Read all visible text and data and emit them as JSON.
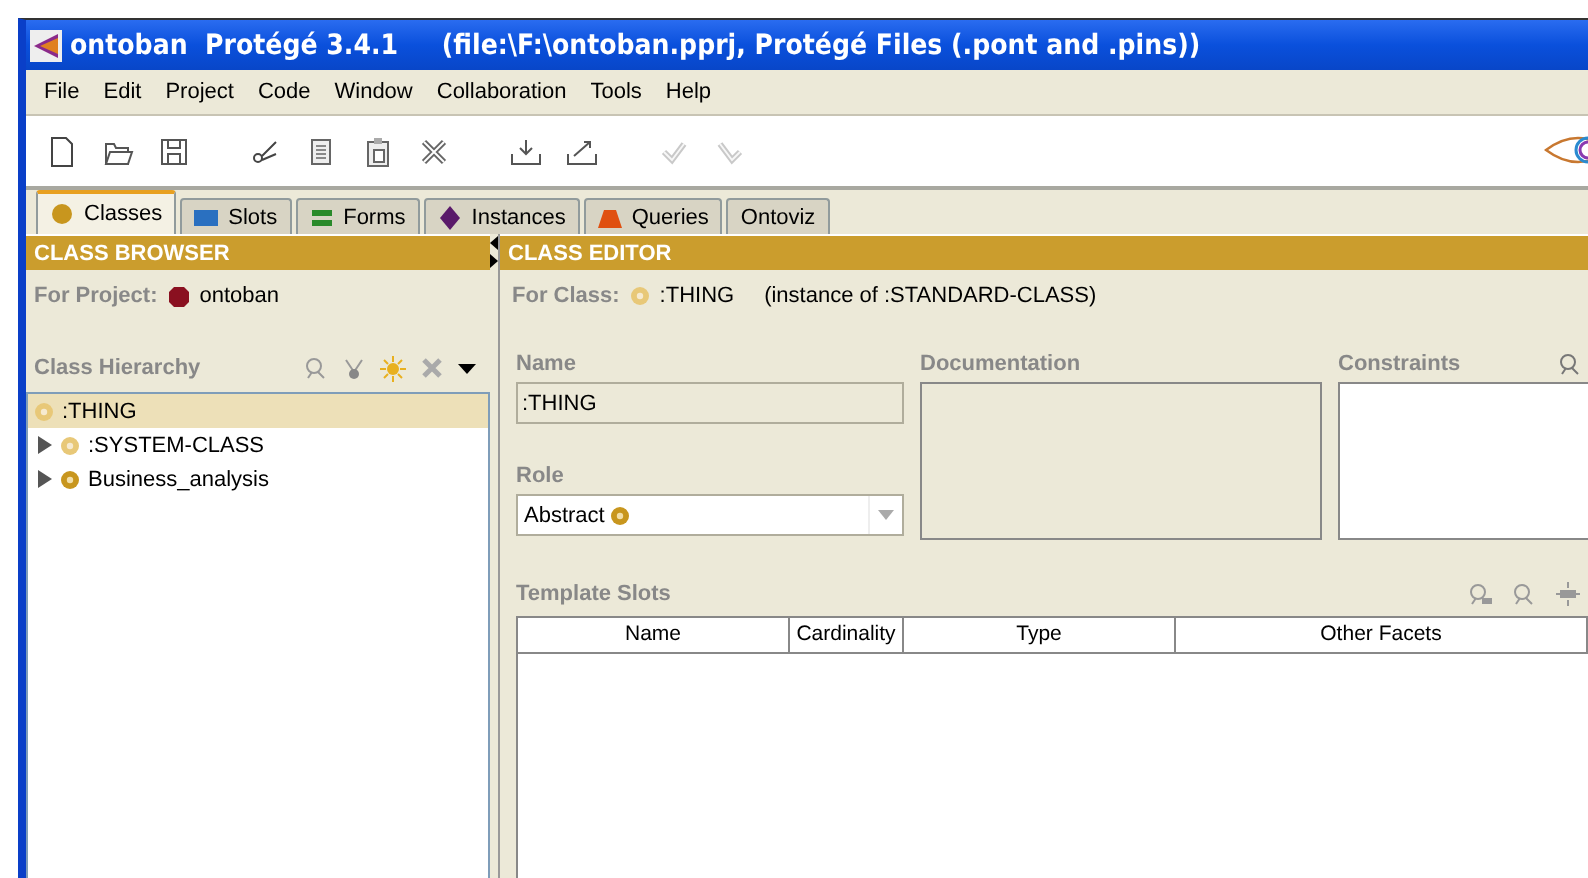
{
  "window": {
    "title": "ontoban  Protégé 3.4.1     (file:\\F:\\ontoban.pprj, Protégé Files (.pont and .pins))"
  },
  "menu": [
    "File",
    "Edit",
    "Project",
    "Code",
    "Window",
    "Collaboration",
    "Tools",
    "Help"
  ],
  "toolbar": [
    {
      "kind": "new",
      "disabled": false
    },
    {
      "kind": "open",
      "disabled": false
    },
    {
      "kind": "save",
      "disabled": false
    },
    {
      "kind": "cut",
      "disabled": false
    },
    {
      "kind": "copy",
      "disabled": false
    },
    {
      "kind": "paste",
      "disabled": false
    },
    {
      "kind": "delete",
      "disabled": false
    },
    {
      "kind": "import",
      "disabled": false
    },
    {
      "kind": "export",
      "disabled": false
    },
    {
      "kind": "undo",
      "disabled": true
    },
    {
      "kind": "redo",
      "disabled": true
    }
  ],
  "tabs": [
    {
      "label": "Classes",
      "kind": "class",
      "selected": true
    },
    {
      "label": "Slots",
      "kind": "slot",
      "selected": false
    },
    {
      "label": "Forms",
      "kind": "form",
      "selected": false
    },
    {
      "label": "Instances",
      "kind": "instance",
      "selected": false
    },
    {
      "label": "Queries",
      "kind": "query",
      "selected": false
    },
    {
      "label": "Ontoviz",
      "kind": "plugin",
      "selected": false
    }
  ],
  "class_browser": {
    "header": "CLASS BROWSER",
    "project_label": "For Project:",
    "project": "ontoban",
    "hierarchy_label": "Class Hierarchy",
    "tree": [
      {
        "label": ":THING",
        "abstract": true,
        "selected": true,
        "children": [
          {
            "label": ":SYSTEM-CLASS",
            "abstract": true,
            "selected": false,
            "expanded": false
          },
          {
            "label": "Business_analysis",
            "abstract": false,
            "selected": false,
            "expanded": false
          }
        ]
      }
    ]
  },
  "class_editor": {
    "header": "CLASS EDITOR",
    "class_label": "For Class:",
    "class_name": ":THING",
    "instance_of": "(instance of :STANDARD-CLASS)",
    "name_label": "Name",
    "name_value": ":THING",
    "documentation_label": "Documentation",
    "constraints_label": "Constraints",
    "role_label": "Role",
    "role_value": "Abstract",
    "template_slots_label": "Template Slots",
    "table": {
      "columns": [
        "Name",
        "Cardinality",
        "Type",
        "Other Facets"
      ]
    }
  }
}
